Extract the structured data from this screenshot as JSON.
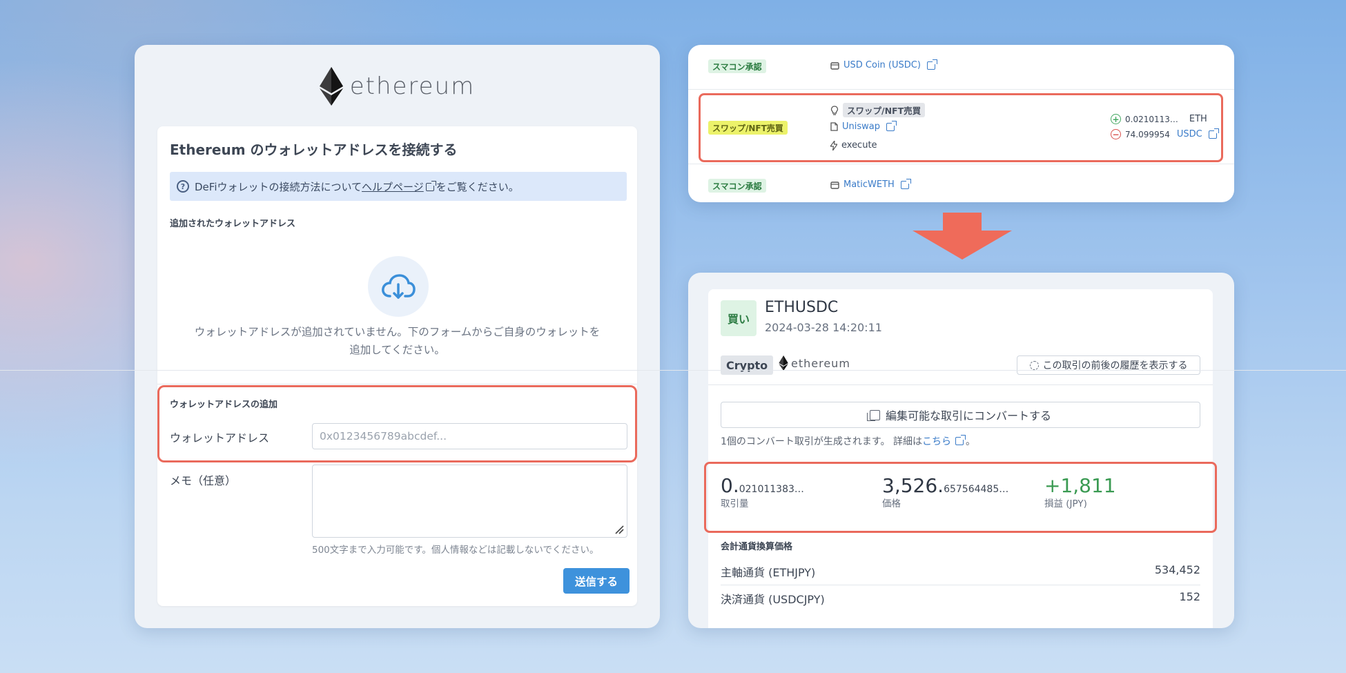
{
  "left": {
    "logo_text": "ethereum",
    "title": "Ethereum のウォレットアドレスを接続する",
    "info": {
      "pre": "DeFiウォレットの接続方法について",
      "link": "ヘルプページ",
      "post": "をご覧ください。"
    },
    "added_label": "追加されたウォレットアドレス",
    "empty_line1": "ウォレットアドレスが追加されていません。下のフォームからご自身のウォレットを",
    "empty_line2": "追加してください。",
    "add_section_label": "ウォレットアドレスの追加",
    "address_label": "ウォレットアドレス",
    "address_placeholder": "0x0123456789abcdef...",
    "memo_label": "メモ（任意）",
    "memo_hint": "500文字まで入力可能です。個人情報などは記載しないでください。",
    "submit_label": "送信する"
  },
  "top": {
    "row1": {
      "badge": "スマコン承認",
      "token": "USD Coin (USDC)"
    },
    "row2": {
      "badge": "スワップ/NFT売買",
      "type_tag": "スワップ/NFT売買",
      "protocol": "Uniswap",
      "action": "execute",
      "in_amount": "0.0210113…",
      "in_symbol": "ETH",
      "out_amount": "74.099954",
      "out_symbol": "USDC"
    },
    "row3": {
      "badge": "スマコン承認",
      "token": "MaticWETH"
    }
  },
  "bottom": {
    "side": "買い",
    "pair": "ETHUSDC",
    "datetime": "2024-03-28 14:20:11",
    "category": "Crypto",
    "chain_logo": "ethereum",
    "history_label": "この取引の前後の履歴を表示する",
    "convert_label": "編集可能な取引にコンバートする",
    "convert_note_pre": "1個のコンバート取引が生成されます。 詳細は",
    "convert_note_link": "こちら",
    "convert_note_post": "。",
    "qty_int": "0.",
    "qty_frac": "021011383…",
    "qty_label": "取引量",
    "price_int": "3,526.",
    "price_frac": "657564485…",
    "price_label": "価格",
    "pnl": "+1,811",
    "pnl_label": "損益 (JPY)",
    "conv_title": "会計通貨換算価格",
    "rates": [
      {
        "label": "主軸通貨 (ETHJPY)",
        "value": "534,452"
      },
      {
        "label": "決済通貨 (USDCJPY)",
        "value": "152"
      }
    ]
  },
  "colors": {
    "highlight": "#ea6a5c",
    "primary_button": "#3e92dc",
    "buy_badge": "#def3e4",
    "swap_badge": "#ecf26a",
    "pnl_positive": "#3a9a52"
  }
}
